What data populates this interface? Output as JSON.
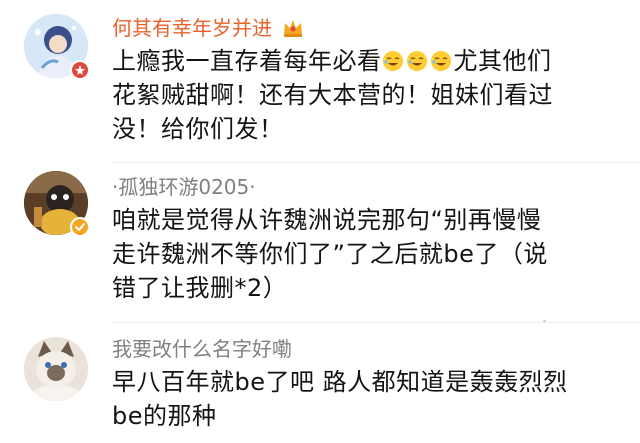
{
  "comments": [
    {
      "username": "何其有幸年岁并进",
      "username_color": "#e8622c",
      "crown_icon": "crown-icon",
      "lines": [
        {
          "before": "上瘾我一直存着每年必看",
          "emojis": [
            "laughing-emoji-icon",
            "laughing-emoji-icon",
            "laughing-emoji-icon"
          ],
          "after": "尤其他们"
        },
        {
          "text": "花絮贼甜啊！还有大本营的！姐妹们看过"
        },
        {
          "text": "没！给你们发！"
        }
      ]
    },
    {
      "username": "·孤独环游0205·",
      "username_color": "#808080",
      "verified_icon": "verified-badge-icon",
      "verified_color": "#f5a623",
      "lines": [
        {
          "text": "咱就是觉得从许魏洲说完那句“别再慢慢"
        },
        {
          "text": "走许魏洲不等你们了”了之后就be了（说"
        },
        {
          "text": "错了让我删*2）"
        }
      ]
    },
    {
      "username": "我要改什么名字好嘞",
      "username_color": "#808080",
      "lines": [
        {
          "text": "早八百年就be了吧 路人都知道是轰轰烈烈"
        },
        {
          "text": "be的那种"
        }
      ]
    }
  ]
}
